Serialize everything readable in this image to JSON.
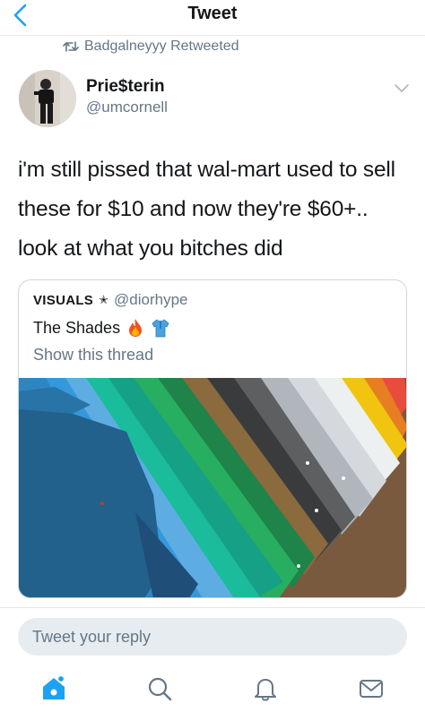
{
  "header": {
    "title": "Tweet",
    "back_icon": "chevron-left-icon"
  },
  "retweet": {
    "label": "Badgalneyyy Retweeted",
    "icon": "retweet-icon"
  },
  "tweet": {
    "display_name": "Prie$terin",
    "handle": "@umcornell",
    "text": "i'm still pissed that wal-mart used to sell these for $10 and now they're $60+.. look at what you bitches did"
  },
  "quoted_tweet": {
    "author_name": "VISUALS",
    "author_symbol": "✭",
    "author_handle": "@diorhype",
    "text": "The Shades",
    "emoji": [
      "fire-icon",
      "shirt-icon"
    ],
    "show_thread": "Show this thread"
  },
  "reply": {
    "placeholder": "Tweet your reply"
  },
  "tabbar": {
    "items": [
      "home-icon",
      "search-icon",
      "notifications-icon",
      "messages-icon"
    ]
  },
  "colors": {
    "accent": "#1da1f2",
    "secondary_text": "#657786",
    "border": "#ccd6dd"
  }
}
